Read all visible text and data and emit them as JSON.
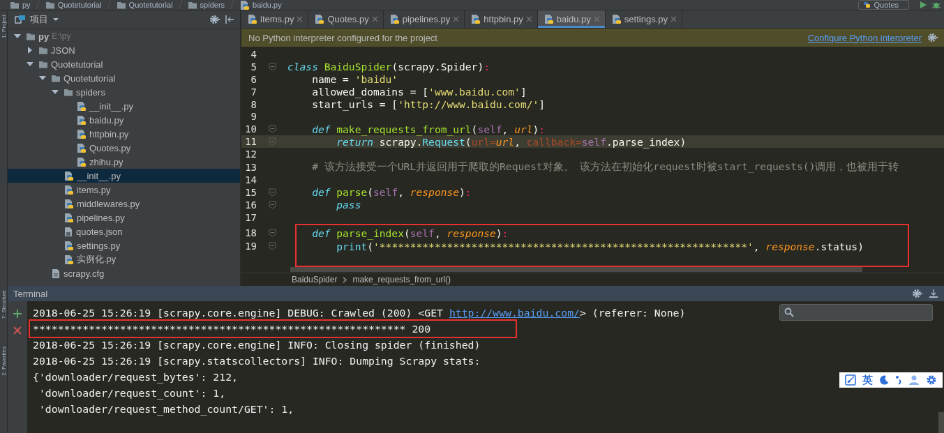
{
  "nav_bar": {
    "crumbs": [
      {
        "label": "py",
        "kind": "folder"
      },
      {
        "label": "Quotetutorial",
        "kind": "folder"
      },
      {
        "label": "Quotetutorial",
        "kind": "folder"
      },
      {
        "label": "spiders",
        "kind": "folder"
      },
      {
        "label": "baidu.py",
        "kind": "py"
      }
    ],
    "run_config": "Quotes"
  },
  "side_strip": {
    "top": [
      "1: Project"
    ],
    "bottom": [
      "7: Structure",
      "2: Favorites"
    ]
  },
  "project": {
    "title": "项目",
    "tree": [
      {
        "label": "py",
        "hint": "E:\\py",
        "kind": "folder",
        "expanded": true,
        "selected": false,
        "children": [
          {
            "label": "JSON",
            "kind": "folder",
            "expanded": false,
            "selected": false
          },
          {
            "label": "Quotetutorial",
            "kind": "folder",
            "expanded": true,
            "selected": false,
            "children": [
              {
                "label": "Quotetutorial",
                "kind": "folder",
                "expanded": true,
                "selected": false,
                "children": [
                  {
                    "label": "spiders",
                    "kind": "folder",
                    "expanded": true,
                    "selected": false,
                    "children": [
                      {
                        "label": "__init__.py",
                        "kind": "py",
                        "selected": false
                      },
                      {
                        "label": "baidu.py",
                        "kind": "py",
                        "selected": false
                      },
                      {
                        "label": "httpbin.py",
                        "kind": "py",
                        "selected": false
                      },
                      {
                        "label": "Quotes.py",
                        "kind": "py",
                        "selected": false
                      },
                      {
                        "label": "zhihu.py",
                        "kind": "py",
                        "selected": false
                      }
                    ]
                  },
                  {
                    "label": "__init__.py",
                    "kind": "py",
                    "selected": true
                  },
                  {
                    "label": "items.py",
                    "kind": "py",
                    "selected": false
                  },
                  {
                    "label": "middlewares.py",
                    "kind": "py",
                    "selected": false
                  },
                  {
                    "label": "pipelines.py",
                    "kind": "py",
                    "selected": false
                  },
                  {
                    "label": "quotes.json",
                    "kind": "json",
                    "selected": false
                  },
                  {
                    "label": "settings.py",
                    "kind": "py",
                    "selected": false
                  },
                  {
                    "label": "实例化.py",
                    "kind": "py",
                    "selected": false
                  }
                ]
              },
              {
                "label": "scrapy.cfg",
                "kind": "cfg",
                "selected": false
              }
            ]
          }
        ]
      }
    ]
  },
  "editor": {
    "tabs": [
      {
        "label": "items.py",
        "selected": false
      },
      {
        "label": "Quotes.py",
        "selected": false
      },
      {
        "label": "pipelines.py",
        "selected": false
      },
      {
        "label": "httpbin.py",
        "selected": false
      },
      {
        "label": "baidu.py",
        "selected": true
      },
      {
        "label": "settings.py",
        "selected": false
      }
    ],
    "notice": {
      "text": "No Python interpreter configured for the project",
      "link": "Configure Python interpreter"
    },
    "lines": [
      {
        "number": "4"
      },
      {
        "number": "5",
        "fold": true,
        "tokens": [
          {
            "kind": "kw",
            "text": "class "
          },
          {
            "kind": "cls",
            "text": "BaiduSpider"
          },
          {
            "kind": "plain",
            "text": "(scrapy.Spider)"
          },
          {
            "kind": "op",
            "text": ":"
          }
        ]
      },
      {
        "number": "6",
        "tokens": [
          {
            "kind": "plain",
            "text": "    name = "
          },
          {
            "kind": "str",
            "text": "'baidu'"
          }
        ]
      },
      {
        "number": "7",
        "tokens": [
          {
            "kind": "plain",
            "text": "    allowed_domains = ["
          },
          {
            "kind": "str",
            "text": "'www.baidu.com'"
          },
          {
            "kind": "plain",
            "text": "]"
          }
        ]
      },
      {
        "number": "8",
        "tokens": [
          {
            "kind": "plain",
            "text": "    start_urls = ["
          },
          {
            "kind": "str",
            "text": "'http://www.baidu.com/'"
          },
          {
            "kind": "plain",
            "text": "]"
          }
        ]
      },
      {
        "number": "9"
      },
      {
        "number": "10",
        "fold": true,
        "tokens": [
          {
            "kind": "kw",
            "text": "    def "
          },
          {
            "kind": "cls",
            "text": "make_requests_from_url"
          },
          {
            "kind": "plain",
            "text": "("
          },
          {
            "kind": "self",
            "text": "self"
          },
          {
            "kind": "plain",
            "text": ", "
          },
          {
            "kind": "param",
            "text": "url"
          },
          {
            "kind": "plain",
            "text": ")"
          },
          {
            "kind": "op",
            "text": ":"
          }
        ]
      },
      {
        "number": "11",
        "fold": true,
        "current": true,
        "tokens": [
          {
            "kind": "kw",
            "text": "        return"
          },
          {
            "kind": "plain",
            "text": " scrapy."
          },
          {
            "kind": "call",
            "text": "Request"
          },
          {
            "kind": "plain",
            "text": "("
          },
          {
            "kind": "kwarg",
            "text": "url="
          },
          {
            "kind": "param",
            "text": "url"
          },
          {
            "kind": "plain",
            "text": ", "
          },
          {
            "kind": "kwarg",
            "text": "callback="
          },
          {
            "kind": "self",
            "text": "self"
          },
          {
            "kind": "plain",
            "text": ".parse_index)"
          }
        ]
      },
      {
        "number": "12"
      },
      {
        "number": "13",
        "tokens": [
          {
            "kind": "comment",
            "text": "    # 该方法接受一个URL并返回用于爬取的Request对象。 该方法在初始化request时被start_requests()调用，也被用于转"
          }
        ]
      },
      {
        "number": "14"
      },
      {
        "number": "15",
        "fold": true,
        "tokens": [
          {
            "kind": "kw",
            "text": "    def "
          },
          {
            "kind": "cls",
            "text": "parse"
          },
          {
            "kind": "plain",
            "text": "("
          },
          {
            "kind": "self",
            "text": "self"
          },
          {
            "kind": "plain",
            "text": ", "
          },
          {
            "kind": "param",
            "text": "response"
          },
          {
            "kind": "plain",
            "text": ")"
          },
          {
            "kind": "op",
            "text": ":"
          }
        ]
      },
      {
        "number": "16",
        "fold": true,
        "tokens": [
          {
            "kind": "kw",
            "text": "        pass"
          }
        ]
      },
      {
        "number": "17"
      },
      {
        "number": "18",
        "fold": true,
        "boxed": true,
        "tokens": [
          {
            "kind": "kw",
            "text": "    def "
          },
          {
            "kind": "cls",
            "text": "parse_index"
          },
          {
            "kind": "plain",
            "text": "("
          },
          {
            "kind": "self",
            "text": "self"
          },
          {
            "kind": "plain",
            "text": ", "
          },
          {
            "kind": "param",
            "text": "response"
          },
          {
            "kind": "plain",
            "text": ")"
          },
          {
            "kind": "op",
            "text": ":"
          }
        ]
      },
      {
        "number": "19",
        "fold": true,
        "boxed": true,
        "tokens": [
          {
            "kind": "call",
            "text": "        print"
          },
          {
            "kind": "plain",
            "text": "("
          },
          {
            "kind": "str",
            "text": "'************************************************************'"
          },
          {
            "kind": "plain",
            "text": ", "
          },
          {
            "kind": "param",
            "text": "response"
          },
          {
            "kind": "plain",
            "text": ".status)"
          }
        ]
      }
    ],
    "breadcrumb": [
      "BaiduSpider",
      "make_requests_from_url()"
    ]
  },
  "terminal": {
    "title": "Terminal",
    "lines": [
      {
        "segments": [
          {
            "kind": "text",
            "text": "2018-06-25 15:26:19 [scrapy.core.engine] DEBUG: Crawled (200) <GET "
          },
          {
            "kind": "link",
            "text": "http://www.baidu.com/"
          },
          {
            "kind": "text",
            "text": "> (referer: None)"
          }
        ]
      },
      {
        "boxed": true,
        "segments": [
          {
            "kind": "text",
            "text": "************************************************************ 200"
          }
        ]
      },
      {
        "segments": [
          {
            "kind": "text",
            "text": "2018-06-25 15:26:19 [scrapy.core.engine] INFO: Closing spider (finished)"
          }
        ]
      },
      {
        "segments": [
          {
            "kind": "text",
            "text": "2018-06-25 15:26:19 [scrapy.statscollectors] INFO: Dumping Scrapy stats:"
          }
        ]
      },
      {
        "segments": [
          {
            "kind": "text",
            "text": "{'downloader/request_bytes': 212,"
          }
        ]
      },
      {
        "segments": [
          {
            "kind": "text",
            "text": " 'downloader/request_count': 1,"
          }
        ]
      },
      {
        "segments": [
          {
            "kind": "text",
            "text": " 'downloader/request_method_count/GET': 1,"
          }
        ]
      }
    ]
  },
  "ime_bar": {
    "mode": "英"
  }
}
